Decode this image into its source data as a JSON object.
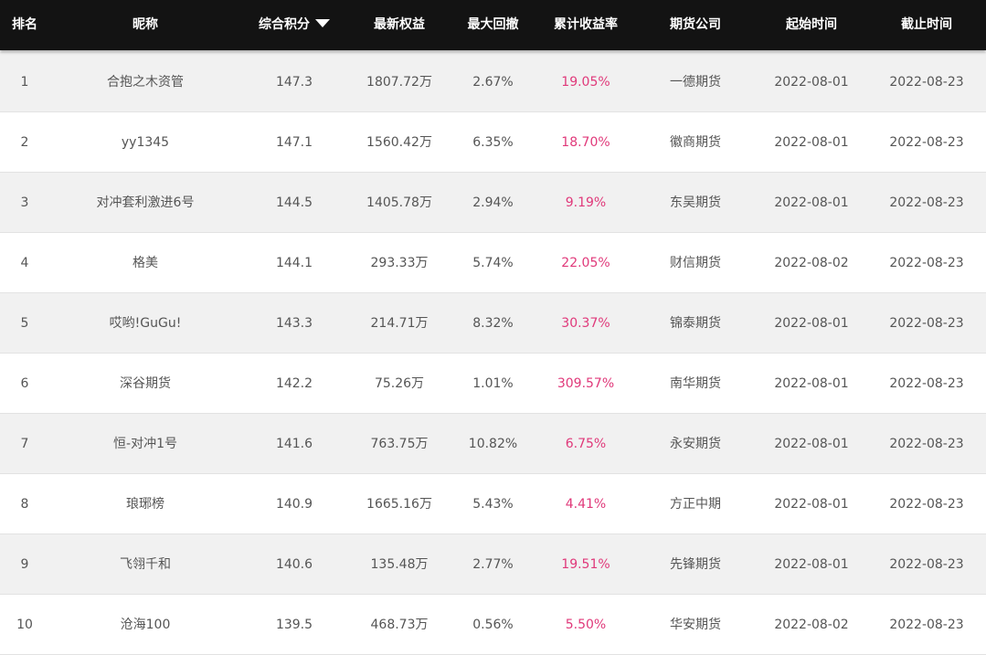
{
  "colors": {
    "header_bg": "#131313",
    "header_text": "#ffffff",
    "row_alt_bg": "#f1f1f1",
    "return_text": "#e0397a",
    "body_text": "#555555"
  },
  "table": {
    "headers": {
      "rank": "排名",
      "nickname": "昵称",
      "score": "综合积分",
      "equity": "最新权益",
      "drawdown": "最大回撤",
      "return": "累计收益率",
      "company": "期货公司",
      "start": "起始时间",
      "end": "截止时间"
    },
    "sort_icon": "triangle-down-icon",
    "rows": [
      {
        "rank": "1",
        "nickname": "合抱之木资管",
        "score": "147.3",
        "equity": "1807.72万",
        "drawdown": "2.67%",
        "return": "19.05%",
        "company": "一德期货",
        "start": "2022-08-01",
        "end": "2022-08-23"
      },
      {
        "rank": "2",
        "nickname": "yy1345",
        "score": "147.1",
        "equity": "1560.42万",
        "drawdown": "6.35%",
        "return": "18.70%",
        "company": "徽商期货",
        "start": "2022-08-01",
        "end": "2022-08-23"
      },
      {
        "rank": "3",
        "nickname": "对冲套利激进6号",
        "score": "144.5",
        "equity": "1405.78万",
        "drawdown": "2.94%",
        "return": "9.19%",
        "company": "东吴期货",
        "start": "2022-08-01",
        "end": "2022-08-23"
      },
      {
        "rank": "4",
        "nickname": "格美",
        "score": "144.1",
        "equity": "293.33万",
        "drawdown": "5.74%",
        "return": "22.05%",
        "company": "财信期货",
        "start": "2022-08-02",
        "end": "2022-08-23"
      },
      {
        "rank": "5",
        "nickname": "哎哟!GuGu!",
        "score": "143.3",
        "equity": "214.71万",
        "drawdown": "8.32%",
        "return": "30.37%",
        "company": "锦泰期货",
        "start": "2022-08-01",
        "end": "2022-08-23"
      },
      {
        "rank": "6",
        "nickname": "深谷期货",
        "score": "142.2",
        "equity": "75.26万",
        "drawdown": "1.01%",
        "return": "309.57%",
        "company": "南华期货",
        "start": "2022-08-01",
        "end": "2022-08-23"
      },
      {
        "rank": "7",
        "nickname": "恒-对冲1号",
        "score": "141.6",
        "equity": "763.75万",
        "drawdown": "10.82%",
        "return": "6.75%",
        "company": "永安期货",
        "start": "2022-08-01",
        "end": "2022-08-23"
      },
      {
        "rank": "8",
        "nickname": "琅琊榜",
        "score": "140.9",
        "equity": "1665.16万",
        "drawdown": "5.43%",
        "return": "4.41%",
        "company": "方正中期",
        "start": "2022-08-01",
        "end": "2022-08-23"
      },
      {
        "rank": "9",
        "nickname": "飞翎千和",
        "score": "140.6",
        "equity": "135.48万",
        "drawdown": "2.77%",
        "return": "19.51%",
        "company": "先锋期货",
        "start": "2022-08-01",
        "end": "2022-08-23"
      },
      {
        "rank": "10",
        "nickname": "沧海100",
        "score": "139.5",
        "equity": "468.73万",
        "drawdown": "0.56%",
        "return": "5.50%",
        "company": "华安期货",
        "start": "2022-08-02",
        "end": "2022-08-23"
      }
    ]
  }
}
